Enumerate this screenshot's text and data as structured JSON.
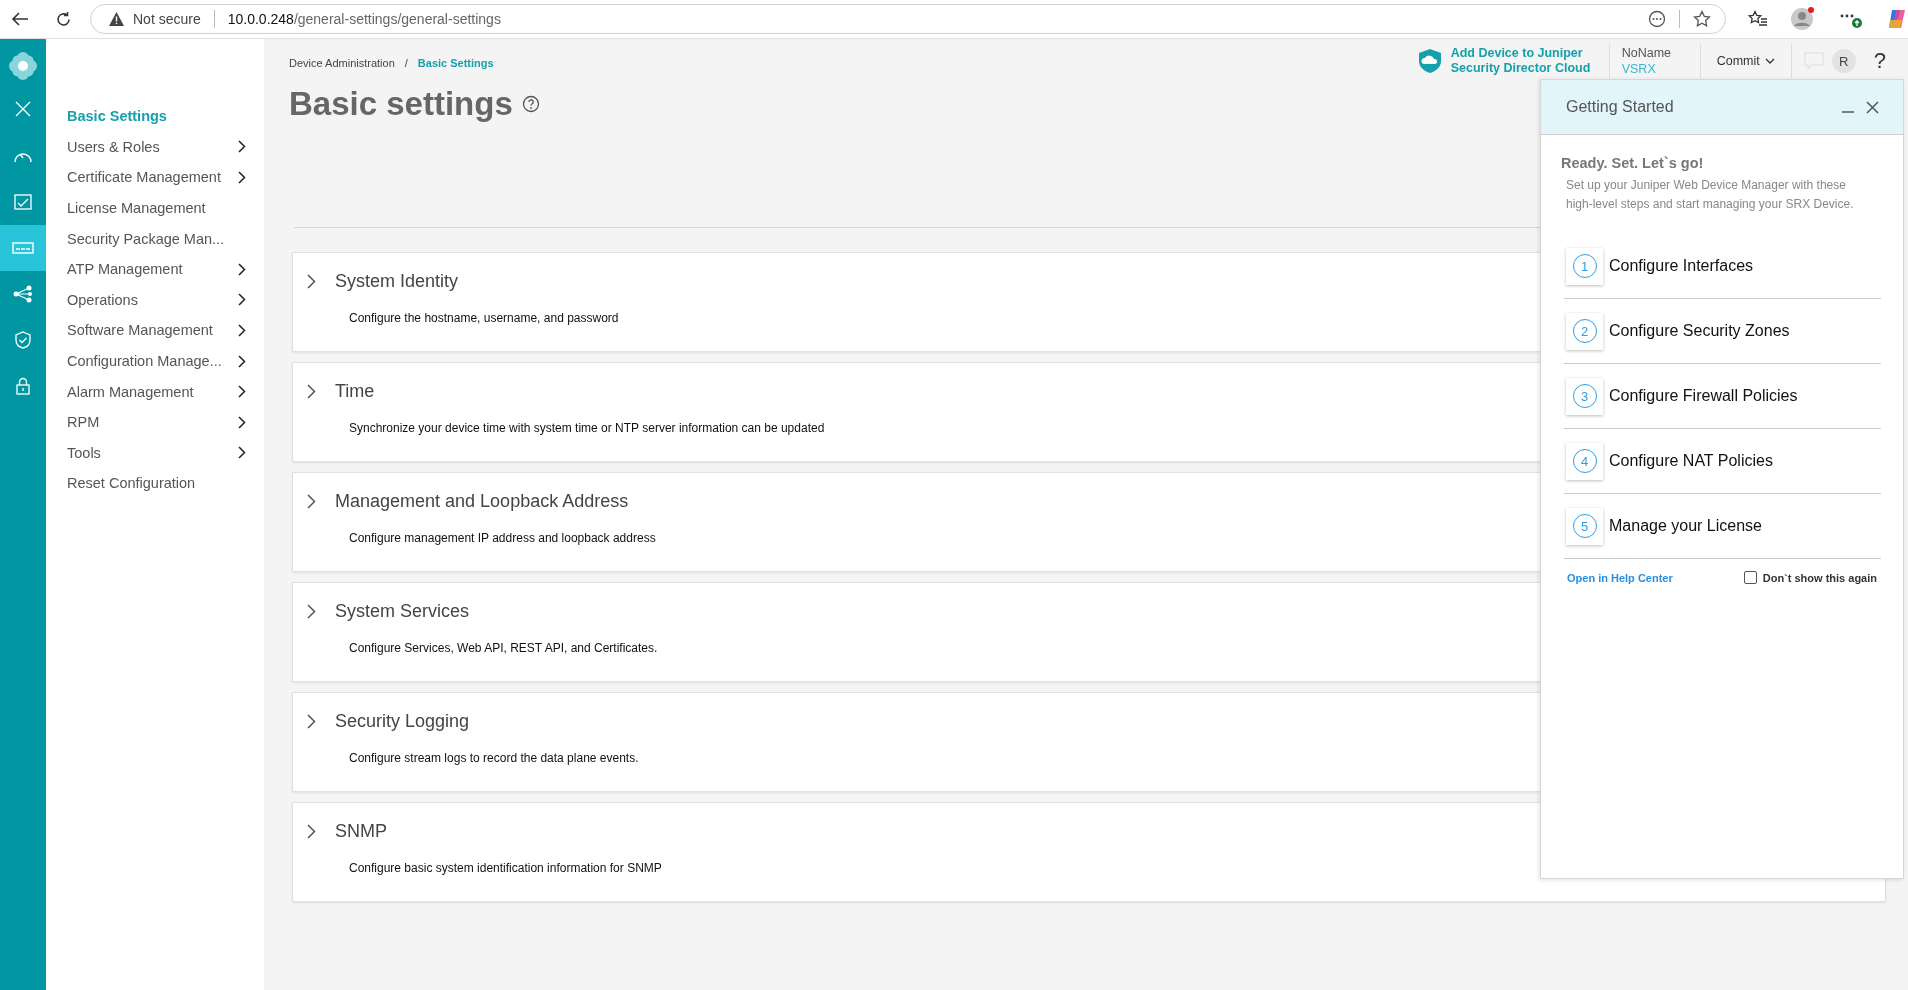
{
  "browser": {
    "security": "Not secure",
    "url_host": "10.0.0.248",
    "url_path": "/general-settings/general-settings"
  },
  "rail": [
    {
      "selected": false
    },
    {
      "selected": false
    },
    {
      "selected": true
    },
    {
      "selected": false
    },
    {
      "selected": false
    },
    {
      "selected": false
    }
  ],
  "menu": [
    {
      "label": "Basic Settings",
      "selected": true,
      "has_children": false
    },
    {
      "label": "Users & Roles",
      "selected": false,
      "has_children": true
    },
    {
      "label": "Certificate Management",
      "selected": false,
      "has_children": true
    },
    {
      "label": "License Management",
      "selected": false,
      "has_children": false
    },
    {
      "label": "Security Package Man...",
      "selected": false,
      "has_children": false
    },
    {
      "label": "ATP Management",
      "selected": false,
      "has_children": true
    },
    {
      "label": "Operations",
      "selected": false,
      "has_children": true
    },
    {
      "label": "Software Management",
      "selected": false,
      "has_children": true
    },
    {
      "label": "Configuration Manage...",
      "selected": false,
      "has_children": true
    },
    {
      "label": "Alarm Management",
      "selected": false,
      "has_children": true
    },
    {
      "label": "RPM",
      "selected": false,
      "has_children": true
    },
    {
      "label": "Tools",
      "selected": false,
      "has_children": true
    },
    {
      "label": "Reset Configuration",
      "selected": false,
      "has_children": false
    }
  ],
  "breadcrumb": [
    "Device Administration",
    "Basic Settings"
  ],
  "breadcrumb_separator": "/",
  "page_title": "Basic settings",
  "header": {
    "cloud_link": "Add Device to Juniper Security Director Cloud",
    "device_name": "NoName",
    "device_model": "VSRX",
    "commit": "Commit",
    "avatar": "R",
    "help": "?"
  },
  "sections": [
    {
      "title": "System Identity",
      "description": "Configure the hostname, username, and password",
      "expanded": false
    },
    {
      "title": "Time",
      "description": "Synchronize your device time with system time or NTP server information can be updated",
      "expanded": false
    },
    {
      "title": "Management and Loopback Address",
      "description": "Configure management IP address and loopback address",
      "expanded": false
    },
    {
      "title": "System Services",
      "description": "Configure Services, Web API, REST API, and Certificates.",
      "expanded": false
    },
    {
      "title": "Security Logging",
      "description": "Configure stream logs to record the data plane events.",
      "expanded": false
    },
    {
      "title": "SNMP",
      "description": "Configure basic system identification information for SNMP",
      "expanded": false
    }
  ],
  "getting_started": {
    "title": "Getting Started",
    "heading": "Ready. Set. Let`s go!",
    "description": "Set up your Juniper Web Device Manager with these high-level steps and start managing your SRX Device.",
    "steps": [
      {
        "number": "1",
        "label": "Configure Interfaces"
      },
      {
        "number": "2",
        "label": "Configure Security Zones"
      },
      {
        "number": "3",
        "label": "Configure Firewall Policies"
      },
      {
        "number": "4",
        "label": "Configure NAT Policies"
      },
      {
        "number": "5",
        "label": "Manage your License"
      }
    ],
    "help_link": "Open in Help Center",
    "dont_show": {
      "label": "Don`t show this again",
      "checked": false
    }
  }
}
